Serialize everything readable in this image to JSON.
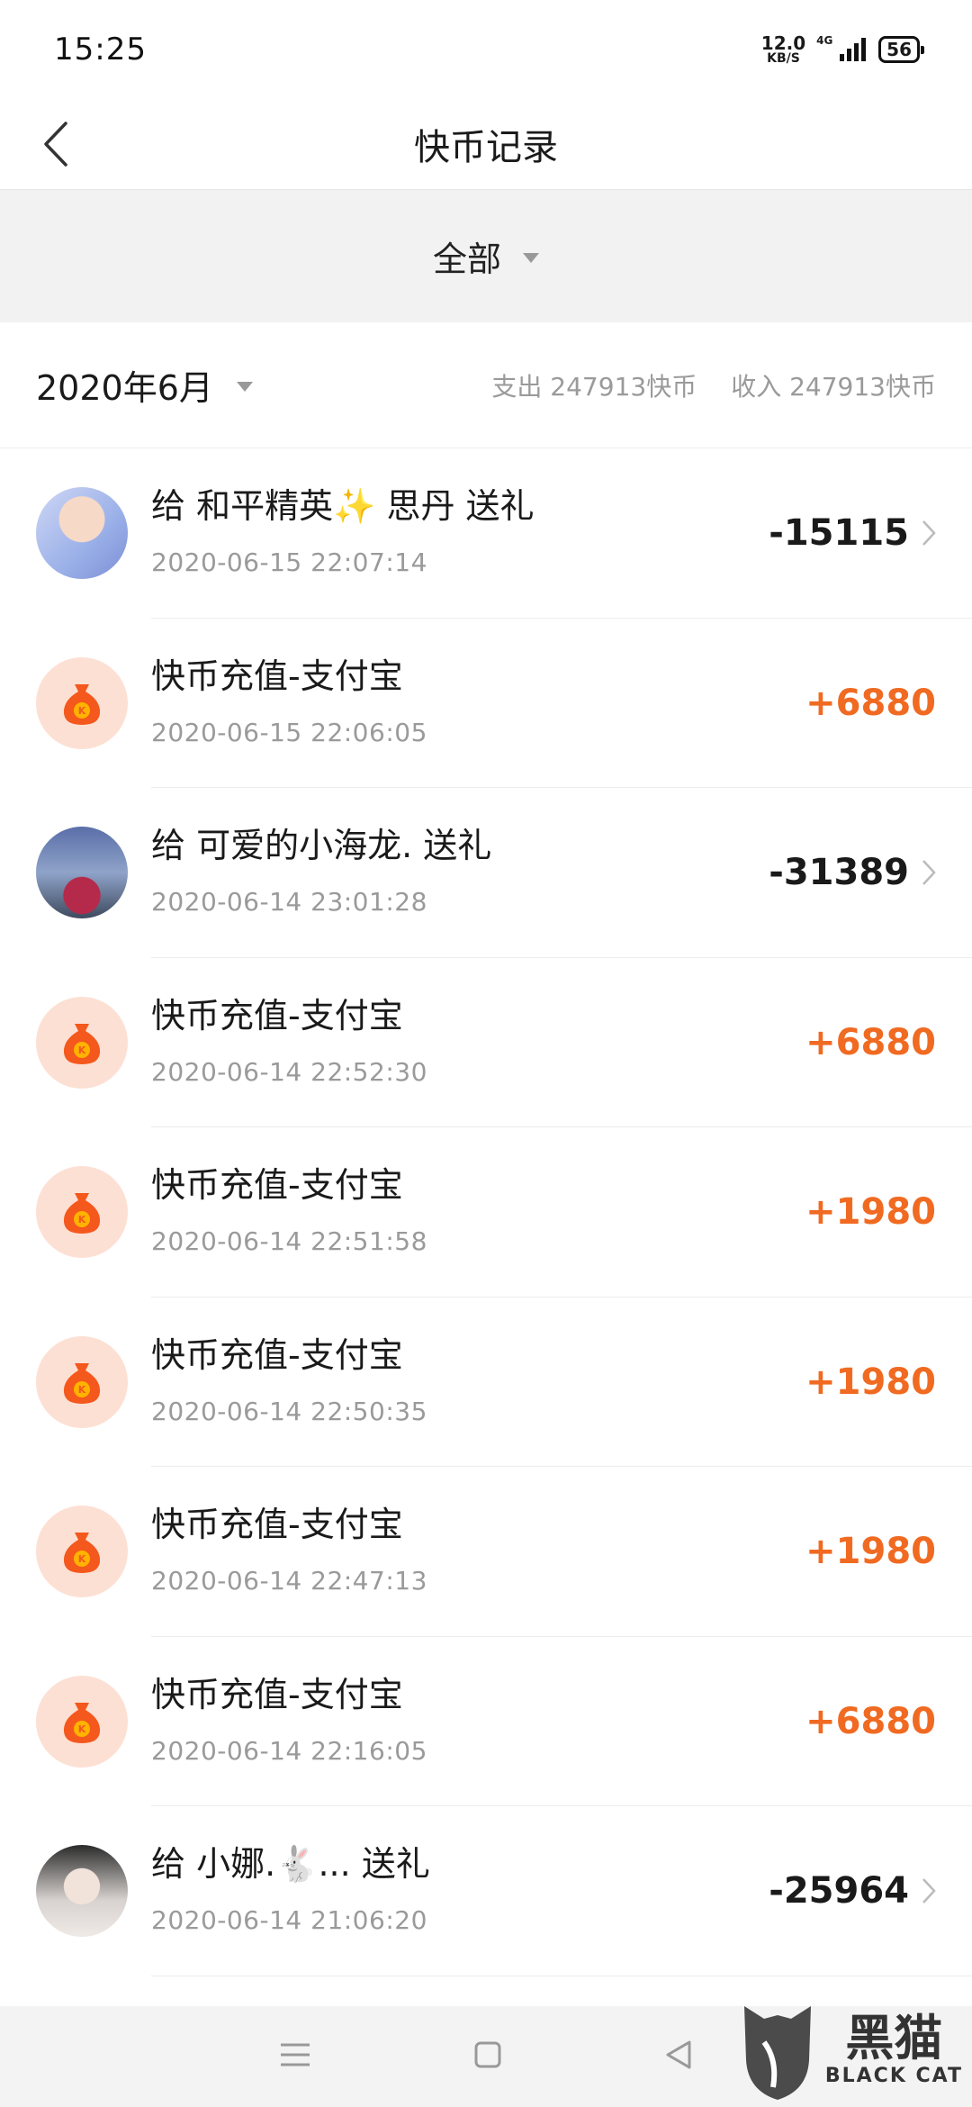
{
  "status_bar": {
    "time": "15:25",
    "net_speed": "12.0",
    "net_unit": "KB/S",
    "network": "4G",
    "battery": "56"
  },
  "nav": {
    "title": "快币记录",
    "back_icon": "chevron-left-icon"
  },
  "filter": {
    "label": "全部"
  },
  "summary": {
    "month": "2020年6月",
    "expense": "支出 247913快币",
    "income": "收入 247913快币"
  },
  "records": [
    {
      "title": "给 和平精英✨ 思丹 送礼",
      "time": "2020-06-15 22:07:14",
      "amount": "-15115",
      "type": "gift"
    },
    {
      "title": "快币充值-支付宝",
      "time": "2020-06-15 22:06:05",
      "amount": "+6880",
      "type": "recharge"
    },
    {
      "title": "给 可爱的小海龙. 送礼",
      "time": "2020-06-14 23:01:28",
      "amount": "-31389",
      "type": "gift"
    },
    {
      "title": "快币充值-支付宝",
      "time": "2020-06-14 22:52:30",
      "amount": "+6880",
      "type": "recharge"
    },
    {
      "title": "快币充值-支付宝",
      "time": "2020-06-14 22:51:58",
      "amount": "+1980",
      "type": "recharge"
    },
    {
      "title": "快币充值-支付宝",
      "time": "2020-06-14 22:50:35",
      "amount": "+1980",
      "type": "recharge"
    },
    {
      "title": "快币充值-支付宝",
      "time": "2020-06-14 22:47:13",
      "amount": "+1980",
      "type": "recharge"
    },
    {
      "title": "快币充值-支付宝",
      "time": "2020-06-14 22:16:05",
      "amount": "+6880",
      "type": "recharge"
    },
    {
      "title": "给 小娜.🐇... 送礼",
      "time": "2020-06-14 21:06:20",
      "amount": "-25964",
      "type": "gift"
    }
  ],
  "colors": {
    "positive": "#f06a21",
    "negative": "#1a1a1a",
    "coin_bg": "#fde0d4",
    "coin": "#f4581c"
  },
  "watermark": {
    "cn": "黑猫",
    "en": "BLACK CAT"
  }
}
